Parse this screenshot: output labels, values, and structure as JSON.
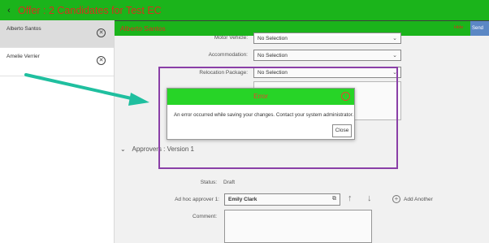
{
  "header": {
    "back_icon": "chevron-left-icon",
    "title": "Offer : 2 Candidates for Test EC"
  },
  "sidebar": {
    "items": [
      {
        "name": "Alberto Santos",
        "remove_icon": "close-circle-icon"
      },
      {
        "name": "Amelie Verrier",
        "remove_icon": "close-circle-icon"
      }
    ]
  },
  "subheader": {
    "name": "Alberto Santos",
    "hide_label": "Hide",
    "send_label": "Send"
  },
  "form": {
    "motor_vehicle_label": "Motor Vehicle:",
    "motor_vehicle_value": "No Selection",
    "accommodation_label": "Accommodation:",
    "accommodation_value": "No Selection",
    "relocation_label": "Relocation Package:",
    "relocation_value": "No Selection"
  },
  "approvers": {
    "section_title": "Approvers : Version 1",
    "status_label": "Status:",
    "status_value": "Draft",
    "adhoc_label": "Ad hoc approver 1:",
    "adhoc_value": "Emily Clark",
    "add_label": "Add Another",
    "comment_label": "Comment:"
  },
  "dialog": {
    "title": "Error",
    "message": "An error occurred while saving your changes. Contact your system administrator.",
    "close_label": "Close"
  },
  "colors": {
    "header_green": "#1bb41b",
    "dialog_green": "#27d427",
    "title_red": "#d6321e",
    "highlight_purple": "#8a3fa7",
    "arrow_teal": "#1fbf9f"
  }
}
